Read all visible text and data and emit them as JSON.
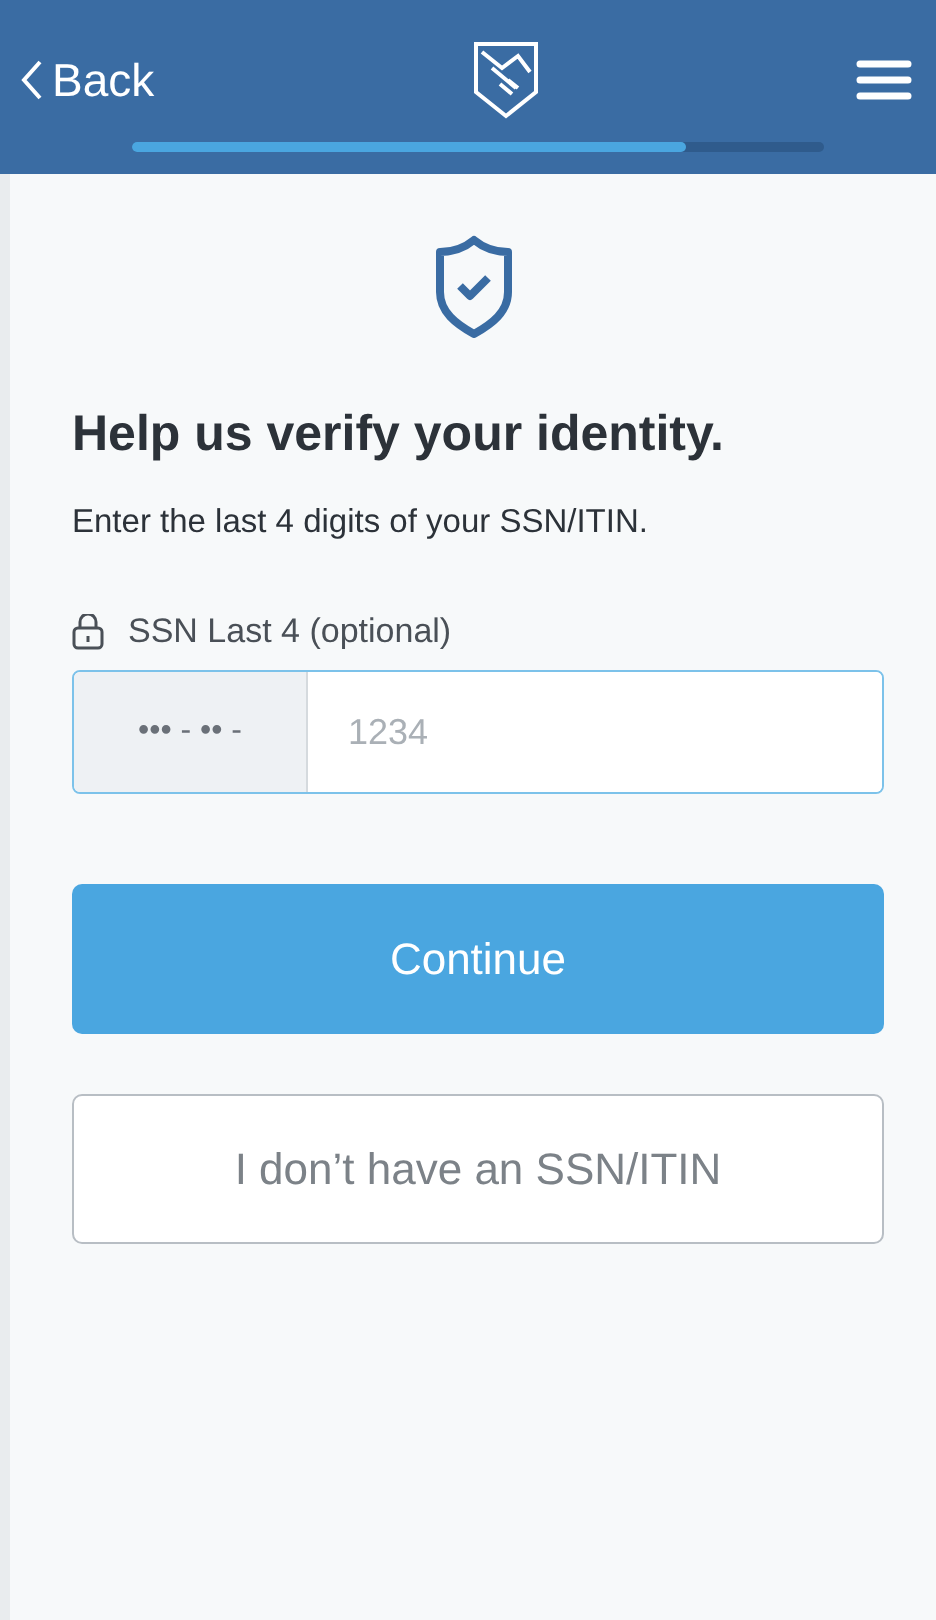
{
  "header": {
    "back": "Back",
    "progress": {
      "level": 0.8
    }
  },
  "title": "Help us verify your identity.",
  "subtitle": "Enter the last 4 digits of your SSN/ITIN.",
  "field": {
    "label": "SSN Last 4 (optional)",
    "prefix": "••• - •• -",
    "placeholder": "1234",
    "focused": true
  },
  "buttons": [
    {
      "label": "Continue",
      "kind": "primary"
    },
    {
      "label": "I don’t have an SSN/ITIN",
      "kind": "secondary"
    }
  ]
}
